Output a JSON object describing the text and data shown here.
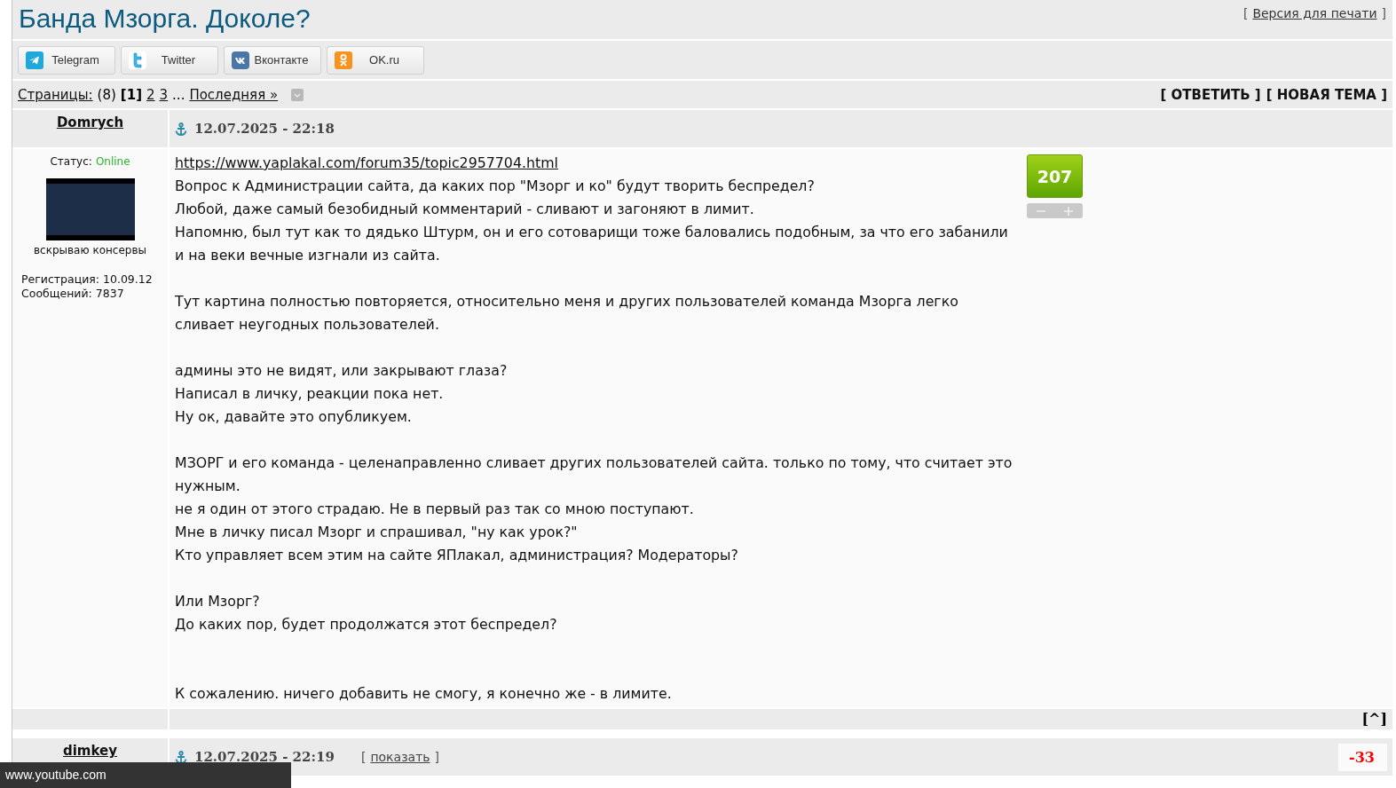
{
  "title": "Банда Мзорга. Доколе?",
  "print_link": {
    "open": "[",
    "label": "Версия для печати",
    "close": "]"
  },
  "share_buttons": [
    {
      "label": "Telegram",
      "kind": "telegram"
    },
    {
      "label": "Twitter",
      "kind": "twitter"
    },
    {
      "label": "Вконтакте",
      "kind": "vk"
    },
    {
      "label": "OK.ru",
      "kind": "ok"
    }
  ],
  "pagination": {
    "label": "Страницы:",
    "count": "(8)",
    "pages": [
      {
        "label": "[1]",
        "selected": true
      },
      {
        "label": "2",
        "selected": false
      },
      {
        "label": "3",
        "selected": false
      }
    ],
    "ellipsis": "...",
    "last": "Последняя »"
  },
  "actions": [
    "[ ОТВЕТИТЬ ]",
    "[ НОВАЯ ТЕМА ]"
  ],
  "posts": [
    {
      "author": "Domrych",
      "date": "12.07.2025 - 22:18",
      "status_label": "Статус:",
      "status": "Online",
      "avatar_caption": "вскрываю консервы",
      "registration": "Регистрация: 10.09.12",
      "messages": "Сообщений: 7837",
      "rating": {
        "value": "207",
        "kind": "badge"
      },
      "link": "https://www.yaplakal.com/forum35/topic2957704.html",
      "paragraphs": [
        [
          "Вопрос к Администрации сайта, да каких пор \"Мзорг и ко\" будут творить беспредел?",
          "Любой, даже самый безобидный комментарий - сливают и загоняют в лимит.",
          "Напомню, был тут как то дядько Штурм, он и его сотоварищи тоже баловались подобным, за что его забанили и на веки вечные изгнали из сайта."
        ],
        [
          "Тут картина полностью повторяется, относительно меня и других пользователей команда Мзорга легко сливает неугодных пользователей."
        ],
        [
          "админы это не видят, или закрывают глаза?",
          "Написал в личку, реакции пока нет.",
          "Ну ок, давайте это опубликуем."
        ],
        [
          "МЗОРГ и его команда - целенаправленно сливает других пользователей сайта. только по тому, что считает это нужным.",
          "не я один от этого страдаю. Не в первый раз так со мною поступают.",
          "Мне в личку писал Мзорг и спрашивал, \"ну как урок?\"",
          "Кто управляет всем этим на сайте ЯПлакал, администрация? Модераторы?"
        ],
        [
          "Или Мзорг?",
          "До каких пор, будет продолжатся этот беспредел?"
        ],
        [
          "К сожалению. ничего добавить не смогу, я конечно же - в лимите."
        ]
      ],
      "top_link": "[^]"
    },
    {
      "author": "dimkey",
      "date": "12.07.2025 - 22:19",
      "show_link": {
        "open": "[",
        "label": "показать",
        "close": "]"
      },
      "rating": {
        "value": "-33",
        "kind": "plain"
      }
    }
  ],
  "status_bubble": "www.youtube.com"
}
